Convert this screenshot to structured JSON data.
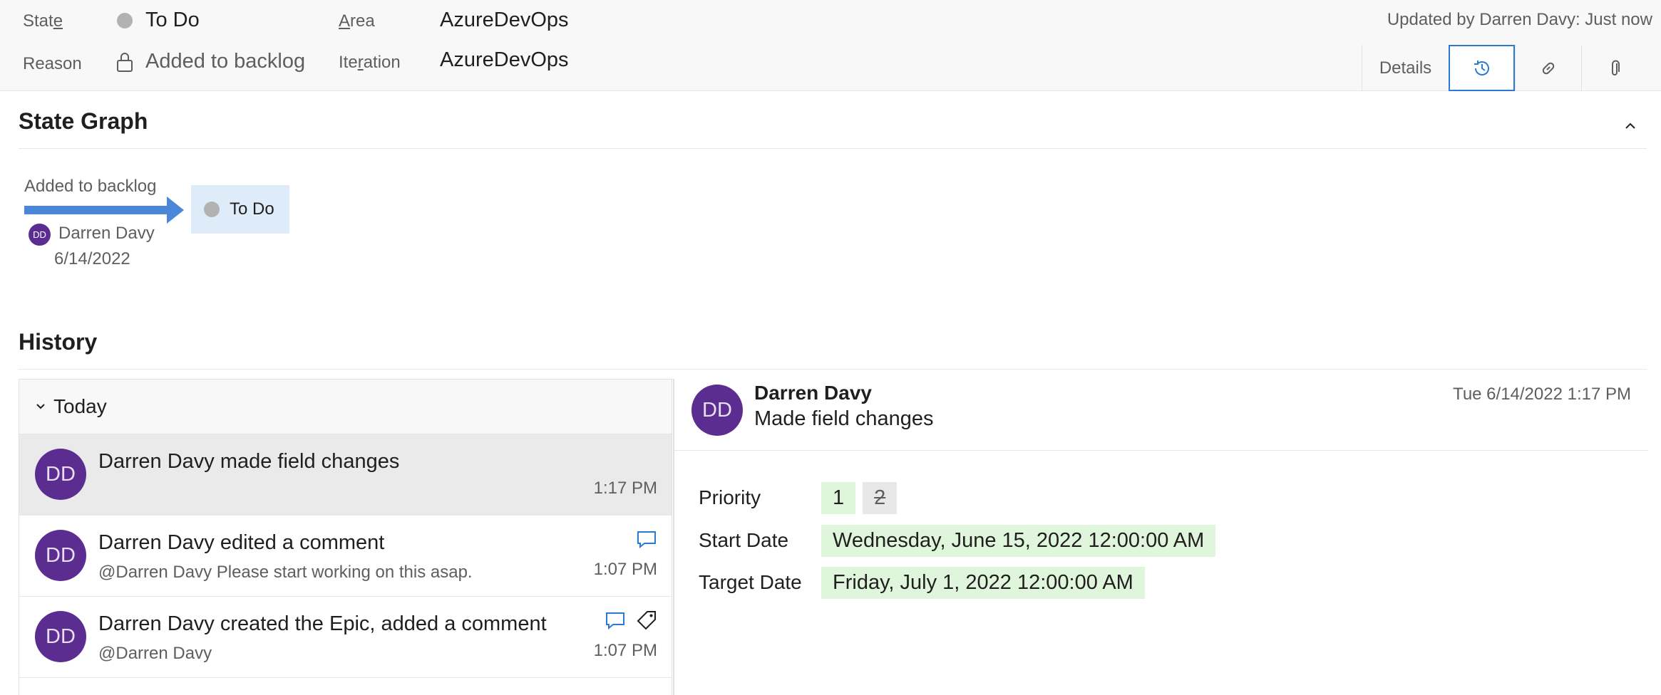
{
  "header": {
    "state_label": "State",
    "state_value": "To Do",
    "reason_label": "Reason",
    "reason_value": "Added to backlog",
    "area_label": "Area",
    "area_value": "AzureDevOps",
    "iteration_label": "Iteration",
    "iteration_value": "AzureDevOps",
    "updated_text": "Updated by Darren Davy: Just now"
  },
  "tabs": [
    {
      "label": "Details",
      "icon": "details"
    },
    {
      "label": "",
      "icon": "history-icon",
      "selected": true
    },
    {
      "label": "",
      "icon": "link-icon"
    },
    {
      "label": "",
      "icon": "paperclip-icon"
    }
  ],
  "state_graph": {
    "title": "State Graph",
    "transition_reason": "Added to backlog",
    "state": "To Do",
    "user_initials": "DD",
    "user_name": "Darren Davy",
    "date": "6/14/2022"
  },
  "history": {
    "title": "History",
    "group_label": "Today",
    "items": [
      {
        "initials": "DD",
        "title": "Darren Davy made field changes",
        "subtitle": "",
        "time": "1:17 PM",
        "icons": []
      },
      {
        "initials": "DD",
        "title": "Darren Davy edited a comment",
        "subtitle": "@Darren Davy Please start working on this asap.",
        "time": "1:07 PM",
        "icons": [
          "comment-icon"
        ]
      },
      {
        "initials": "DD",
        "title": "Darren Davy created the Epic, added a comment",
        "subtitle": "@Darren Davy",
        "time": "1:07 PM",
        "icons": [
          "comment-icon",
          "tag-icon"
        ]
      }
    ]
  },
  "detail": {
    "initials": "DD",
    "name": "Darren Davy",
    "action": "Made field changes",
    "date": "Tue 6/14/2022 1:17 PM",
    "changes": [
      {
        "field": "Priority",
        "new": "1",
        "old": "2"
      },
      {
        "field": "Start Date",
        "new": "Wednesday, June 15, 2022 12:00:00 AM",
        "old": ""
      },
      {
        "field": "Target Date",
        "new": "Friday, July 1, 2022 12:00:00 AM",
        "old": ""
      }
    ]
  },
  "colors": {
    "accent": "#2b7bd6",
    "avatar": "#5c2d91",
    "state_bg": "#deecf9",
    "added_bg": "#dff6dd"
  }
}
